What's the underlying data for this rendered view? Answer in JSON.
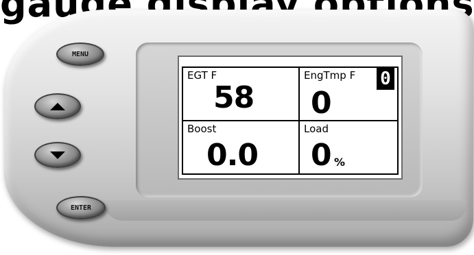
{
  "header": {
    "title": "gauge display options"
  },
  "buttons": {
    "menu": "MENU",
    "enter": "ENTER"
  },
  "screen": {
    "badge": "0",
    "cells": [
      {
        "label": "EGT F",
        "value": "58",
        "unit": ""
      },
      {
        "label": "EngTmp F",
        "value": "0",
        "unit": ""
      },
      {
        "label": "Boost",
        "value": "0.0",
        "unit": ""
      },
      {
        "label": "Load",
        "value": "0",
        "unit": "%"
      }
    ]
  },
  "colors": {
    "screen_bg": "#ffffff",
    "device_body": "#d9d9d9",
    "text": "#000000"
  },
  "icons": [
    "up-arrow-icon",
    "down-arrow-icon"
  ]
}
